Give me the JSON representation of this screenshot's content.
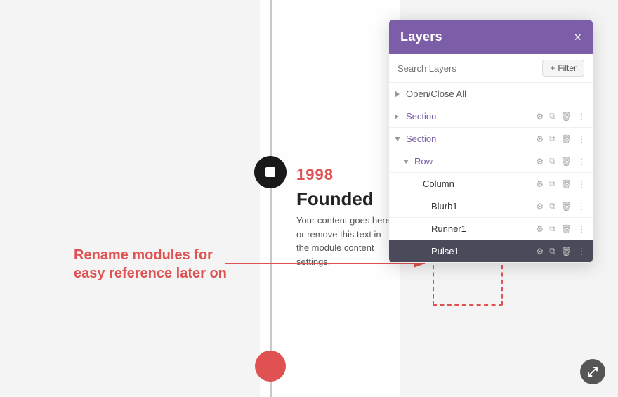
{
  "canvas": {
    "bg_color": "#f4f4f4"
  },
  "timeline": {
    "year": "1998",
    "heading": "Founded",
    "content": "Your content goes here or remove this text in the module content settings."
  },
  "annotation": {
    "text": "Rename modules for easy reference later on"
  },
  "layers_panel": {
    "title": "Layers",
    "close_label": "×",
    "search_placeholder": "Search Layers",
    "filter_label": "+ Filter",
    "open_close_label": "Open/Close All",
    "items": [
      {
        "id": "section1",
        "label": "Section",
        "indent": 0,
        "has_arrow": true,
        "arrow_dir": "right",
        "selected": false
      },
      {
        "id": "section2",
        "label": "Section",
        "indent": 0,
        "has_arrow": true,
        "arrow_dir": "down",
        "selected": false
      },
      {
        "id": "row1",
        "label": "Row",
        "indent": 1,
        "has_arrow": true,
        "arrow_dir": "down",
        "selected": false
      },
      {
        "id": "column1",
        "label": "Column",
        "indent": 2,
        "has_arrow": false,
        "selected": false
      },
      {
        "id": "blurb1",
        "label": "Blurb1",
        "indent": 3,
        "has_arrow": false,
        "selected": false
      },
      {
        "id": "runner1",
        "label": "Runner1",
        "indent": 3,
        "has_arrow": false,
        "selected": false
      },
      {
        "id": "pulse1",
        "label": "Pulse1",
        "indent": 3,
        "has_arrow": false,
        "selected": true
      }
    ]
  },
  "bottom_icon": {
    "name": "resize-icon"
  }
}
